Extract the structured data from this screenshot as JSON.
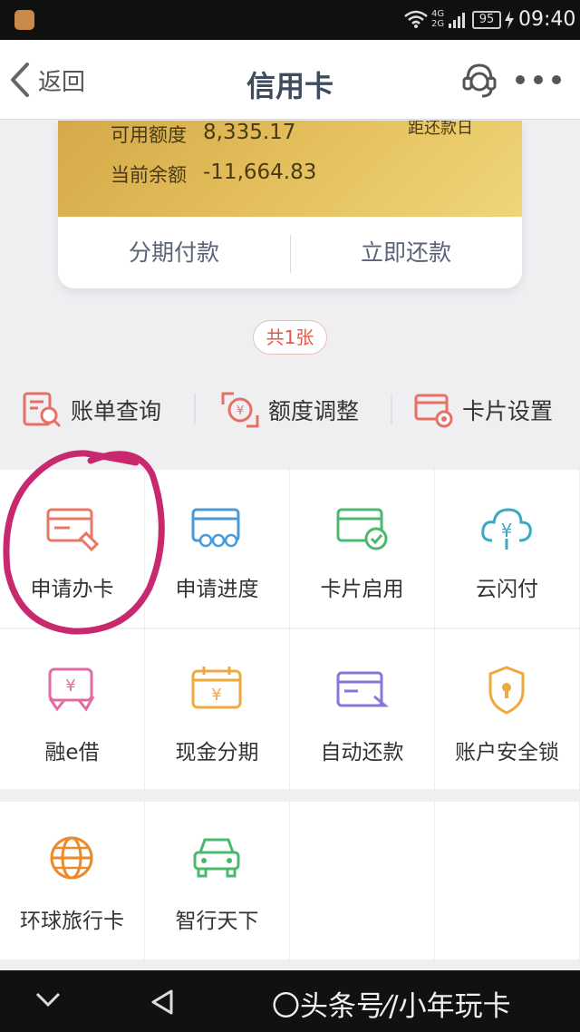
{
  "status_bar": {
    "network": "4G\n2G",
    "battery": "95",
    "time": "09:40"
  },
  "nav": {
    "back_label": "返回",
    "title": "信用卡"
  },
  "card": {
    "available_label": "可用额度",
    "available_value": "8,335.17",
    "balance_label": "当前余额",
    "balance_value": "-11,664.83",
    "due_label": "距还款日",
    "installment_label": "分期付款",
    "repay_label": "立即还款"
  },
  "card_count": "共1张",
  "quick_actions": [
    {
      "label": "账单查询",
      "icon": "bill-search-icon"
    },
    {
      "label": "额度调整",
      "icon": "limit-adjust-icon"
    },
    {
      "label": "卡片设置",
      "icon": "card-settings-icon"
    }
  ],
  "grid": [
    {
      "label": "申请办卡",
      "icon": "apply-card-icon"
    },
    {
      "label": "申请进度",
      "icon": "progress-card-icon"
    },
    {
      "label": "卡片启用",
      "icon": "activate-card-icon"
    },
    {
      "label": "云闪付",
      "icon": "cloud-pay-icon"
    },
    {
      "label": "融e借",
      "icon": "loan-icon"
    },
    {
      "label": "现金分期",
      "icon": "cash-installment-icon"
    },
    {
      "label": "自动还款",
      "icon": "auto-repay-icon"
    },
    {
      "label": "账户安全锁",
      "icon": "security-lock-icon"
    },
    {
      "label": "环球旅行卡",
      "icon": "globe-icon"
    },
    {
      "label": "智行天下",
      "icon": "car-icon"
    }
  ],
  "watermark": "〇头条号⁄/小年玩卡",
  "colors": {
    "accent_red": "#e05a47",
    "card_gold": "#e6c25f",
    "annotation": "#c8286e"
  }
}
